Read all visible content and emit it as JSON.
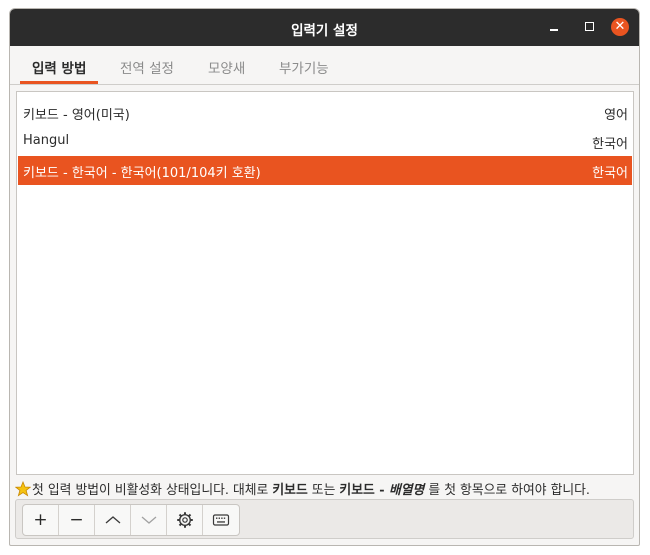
{
  "window": {
    "title": "입력기 설정"
  },
  "tabs": [
    {
      "label": "입력 방법"
    },
    {
      "label": "전역 설정"
    },
    {
      "label": "모양새"
    },
    {
      "label": "부가기능"
    }
  ],
  "input_methods": [
    {
      "name": "키보드 - 영어(미국)",
      "language": "영어"
    },
    {
      "name": "Hangul",
      "language": "한국어"
    },
    {
      "name": "키보드 - 한국어 - 한국어(101/104키 호환)",
      "language": "한국어"
    }
  ],
  "notice": {
    "part1": "첫 입력 방법이 비활성화 상태입니다. 대체로 ",
    "bold1": "키보드",
    "part2": " 또는 ",
    "bold2": "키보드 - ",
    "italic": "배열명",
    "part3": " 를 첫 항목으로 하여야 합니다."
  },
  "toolbar": {
    "add": "+",
    "remove": "−"
  },
  "colors": {
    "accent": "#e95420",
    "titlebar": "#2c2c2c"
  },
  "icons": [
    "star-icon",
    "chevron-up-icon",
    "chevron-down-icon",
    "gear-icon",
    "keyboard-icon"
  ]
}
